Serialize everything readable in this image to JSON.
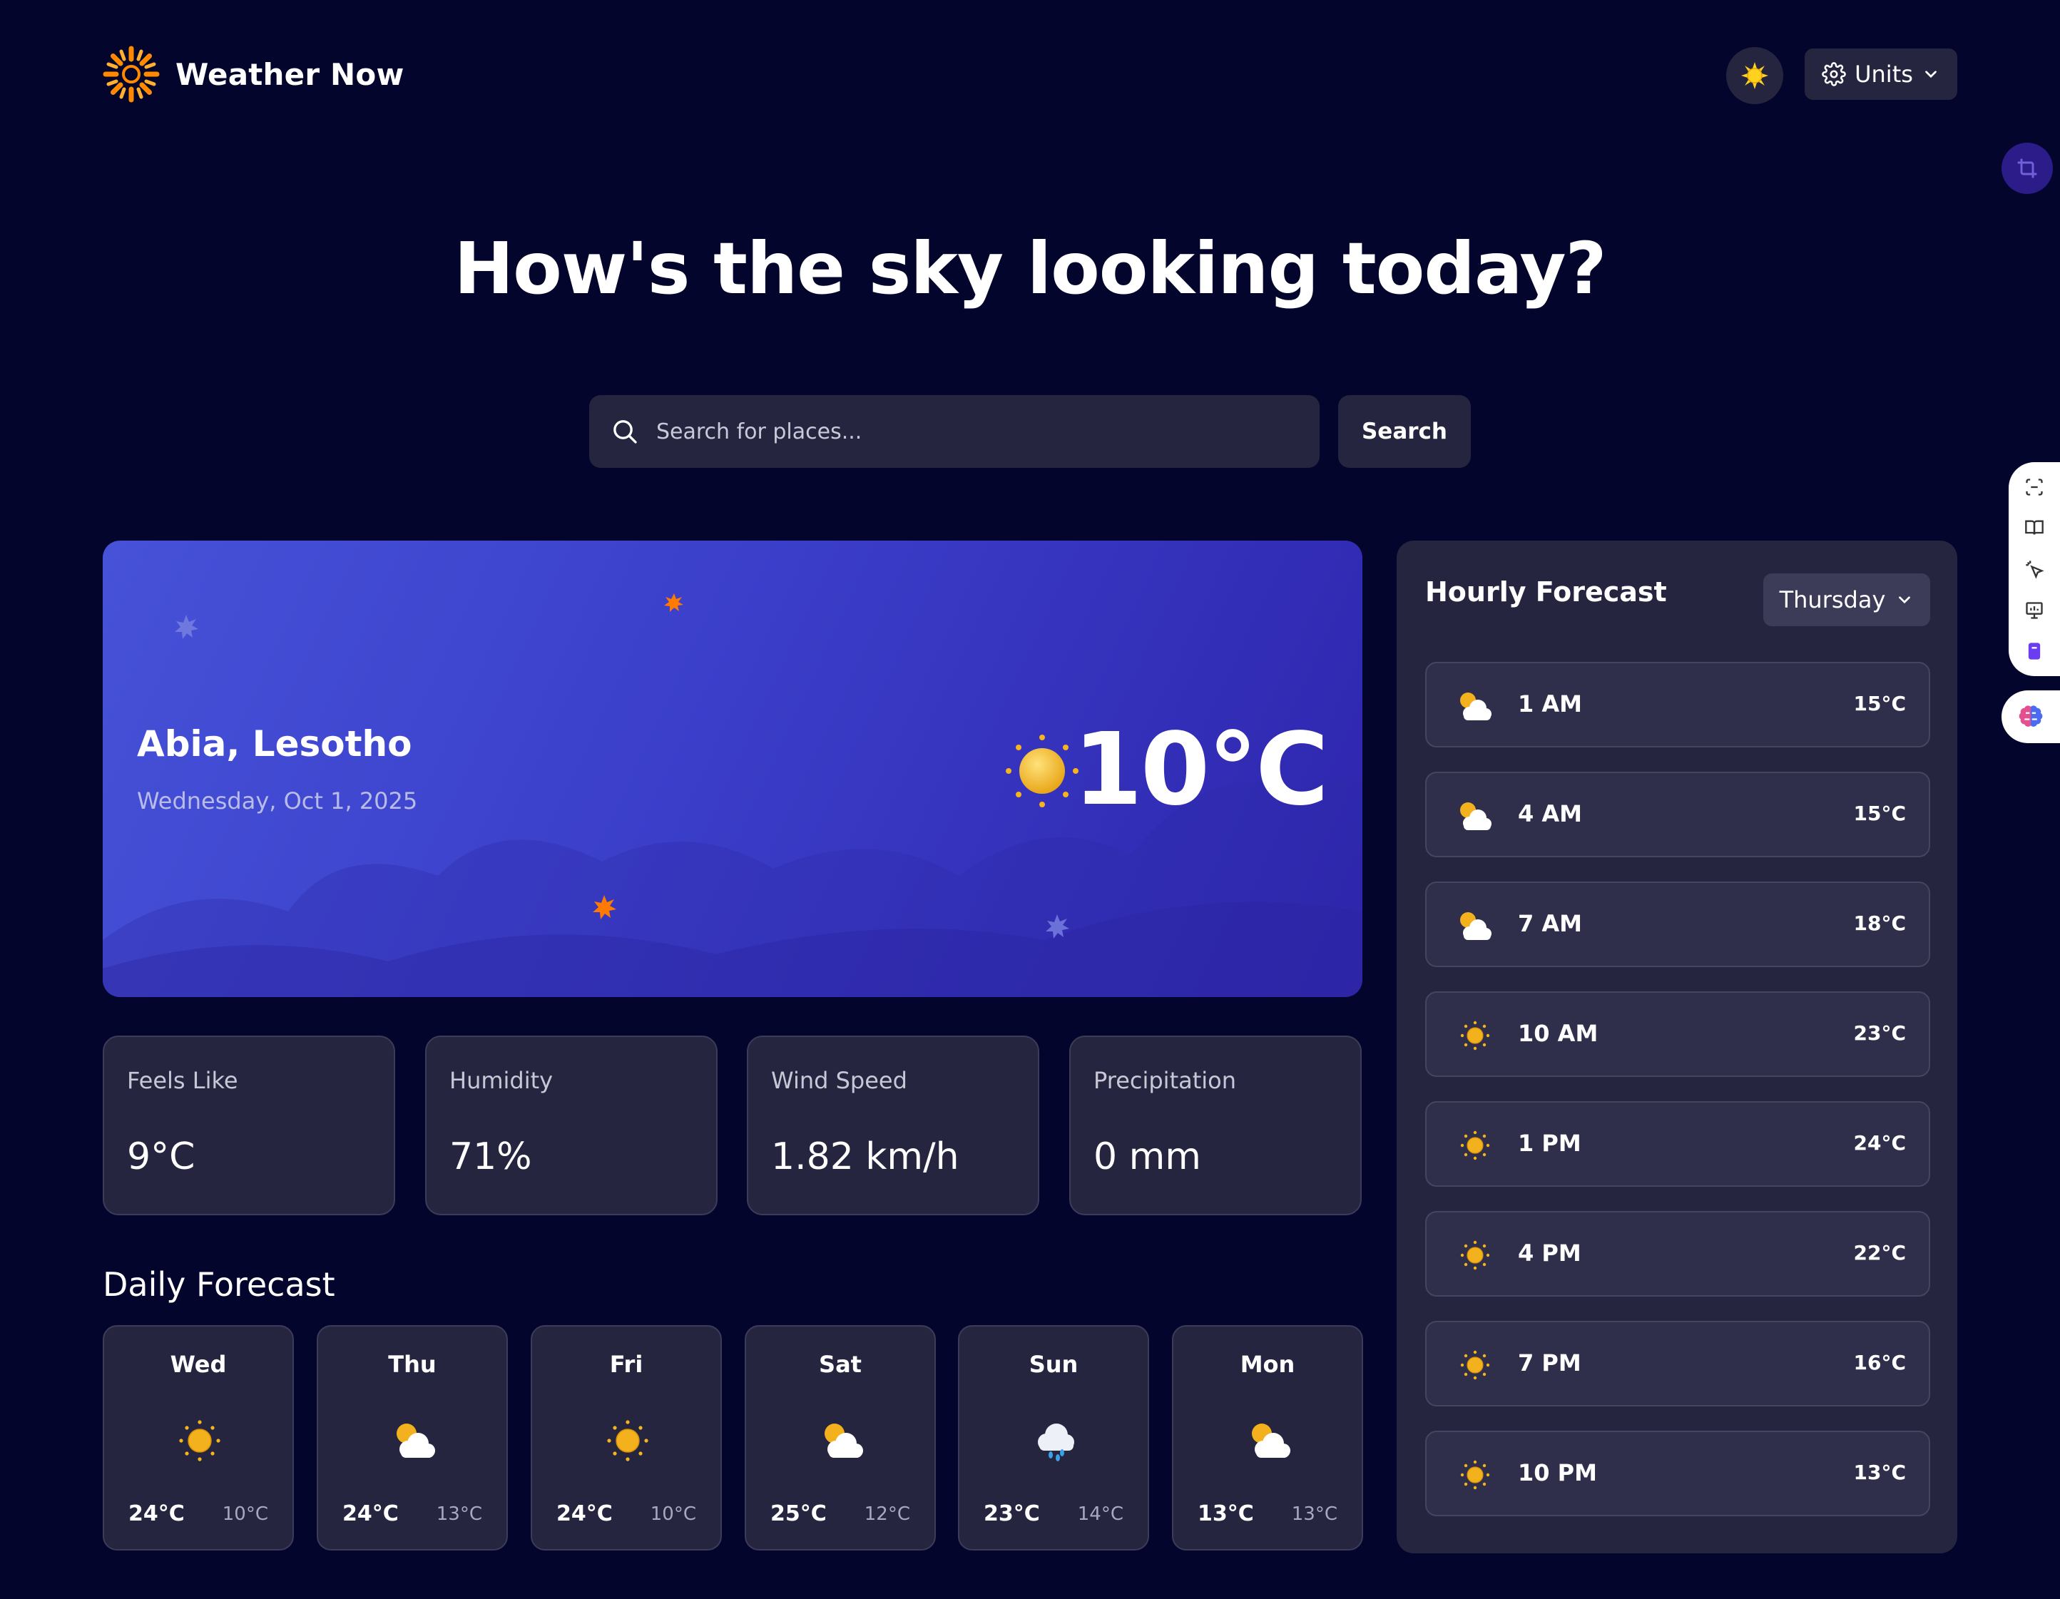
{
  "app": {
    "name": "Weather Now",
    "theme_icon": "sun-icon",
    "units_label": "Units"
  },
  "hero": {
    "title": "How's the sky looking today?"
  },
  "search": {
    "placeholder": "Search for places...",
    "value": "",
    "button_label": "Search"
  },
  "current": {
    "location": "Abia, Lesotho",
    "date": "Wednesday, Oct 1, 2025",
    "temperature": "10°C",
    "condition_icon": "sunny-icon",
    "card_gradient": [
      "#4652d8",
      "#2e24ad"
    ]
  },
  "stats": [
    {
      "label": "Feels Like",
      "value": "9°C"
    },
    {
      "label": "Humidity",
      "value": "71%"
    },
    {
      "label": "Wind Speed",
      "value": "1.82 km/h"
    },
    {
      "label": "Precipitation",
      "value": "0 mm"
    }
  ],
  "daily": {
    "title": "Daily Forecast",
    "days": [
      {
        "day": "Wed",
        "icon": "sunny-icon",
        "high": "24°C",
        "low": "10°C"
      },
      {
        "day": "Thu",
        "icon": "partly-cloudy-icon",
        "high": "24°C",
        "low": "13°C"
      },
      {
        "day": "Fri",
        "icon": "sunny-icon",
        "high": "24°C",
        "low": "10°C"
      },
      {
        "day": "Sat",
        "icon": "partly-cloudy-icon",
        "high": "25°C",
        "low": "12°C"
      },
      {
        "day": "Sun",
        "icon": "rain-icon",
        "high": "23°C",
        "low": "14°C"
      },
      {
        "day": "Mon",
        "icon": "partly-cloudy-icon",
        "high": "13°C",
        "low": "13°C"
      }
    ]
  },
  "hourly": {
    "title": "Hourly Forecast",
    "selected_day": "Thursday",
    "hours": [
      {
        "time": "1 AM",
        "icon": "partly-cloudy-icon",
        "temp": "15°C"
      },
      {
        "time": "4 AM",
        "icon": "partly-cloudy-icon",
        "temp": "15°C"
      },
      {
        "time": "7 AM",
        "icon": "partly-cloudy-icon",
        "temp": "18°C"
      },
      {
        "time": "10 AM",
        "icon": "sunny-icon",
        "temp": "23°C"
      },
      {
        "time": "1 PM",
        "icon": "sunny-icon",
        "temp": "24°C"
      },
      {
        "time": "4 PM",
        "icon": "sunny-icon",
        "temp": "22°C"
      },
      {
        "time": "7 PM",
        "icon": "sunny-icon",
        "temp": "16°C"
      },
      {
        "time": "10 PM",
        "icon": "sunny-icon",
        "temp": "13°C"
      }
    ]
  },
  "colors": {
    "background": "#04052c",
    "surface": "#262540",
    "accent_orange": "#ff8a00",
    "sun_yellow": "#f5b51e"
  }
}
